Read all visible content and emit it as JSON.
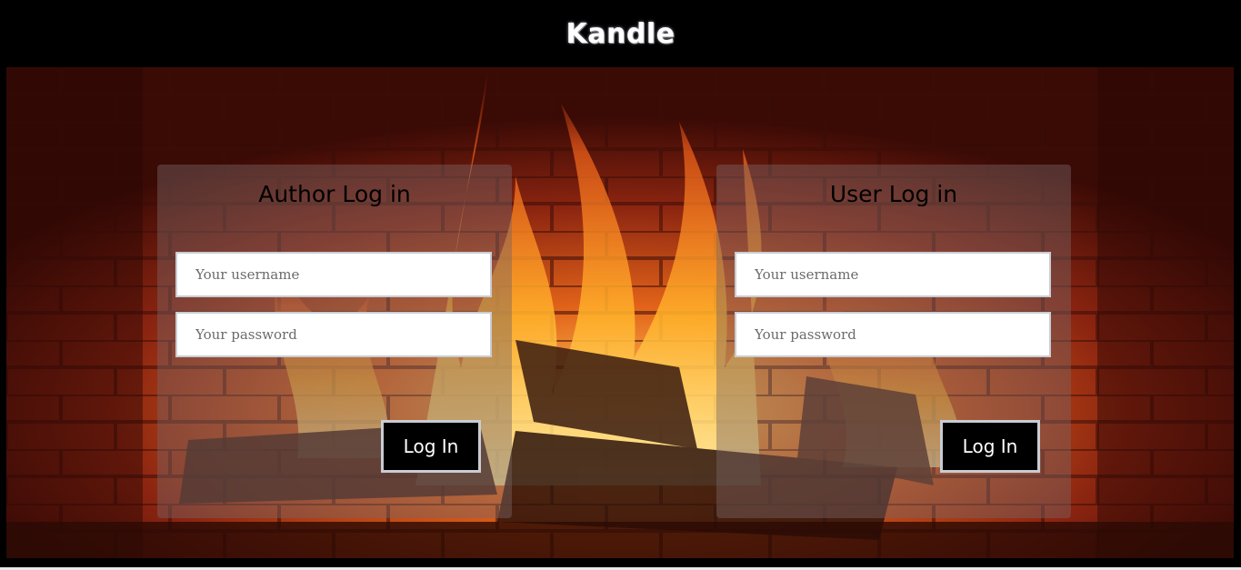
{
  "header": {
    "title": "Kandle"
  },
  "author_panel": {
    "title": "Author Log in",
    "username_placeholder": "Your username",
    "password_placeholder": "Your password",
    "button_label": "Log In"
  },
  "user_panel": {
    "title": "User Log in",
    "username_placeholder": "Your username",
    "password_placeholder": "Your password",
    "button_label": "Log In"
  },
  "colors": {
    "header_bg": "#000000",
    "button_bg": "#000000",
    "button_border": "#c9ccd3",
    "brick": "#8a2a14",
    "flame": "#ff9a1f"
  }
}
